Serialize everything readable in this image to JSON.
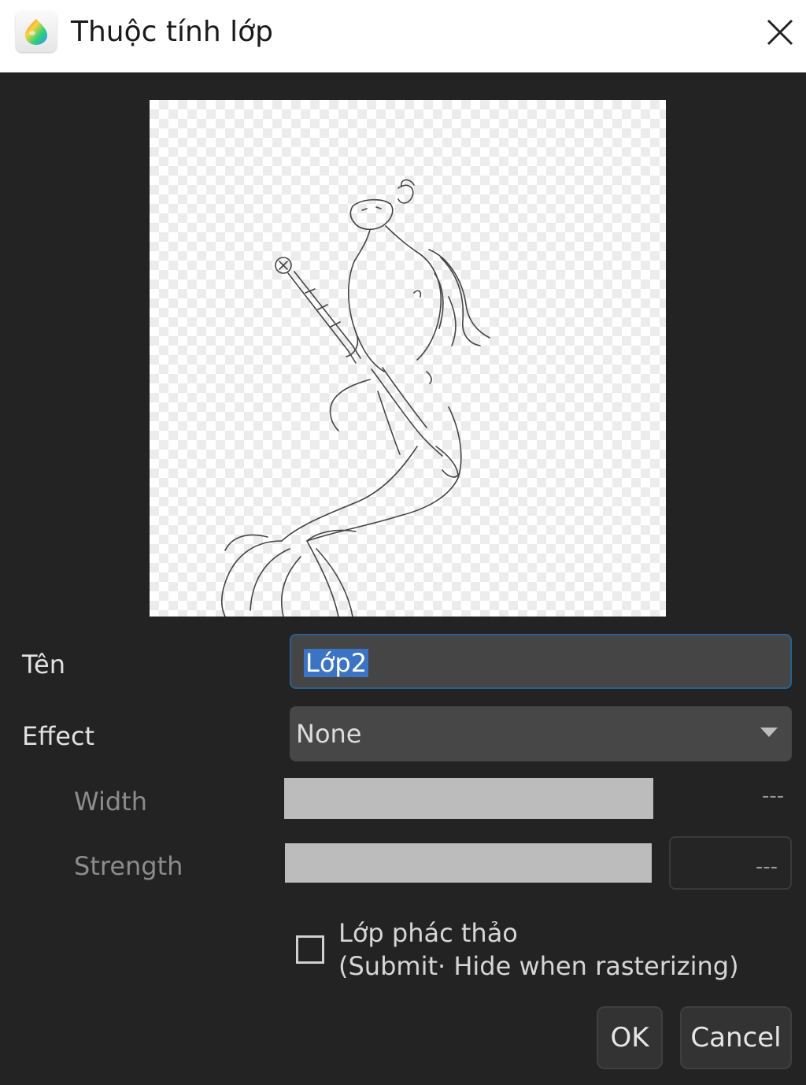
{
  "window": {
    "title": "Thuộc tính lớp",
    "icon": "medibang-paint-logo-icon",
    "close_icon": "close-icon"
  },
  "preview": {
    "icon": "layer-thumbnail",
    "background": "transparency-checkerboard",
    "line_color": "#444444"
  },
  "form": {
    "name_label": "Tên",
    "name_value": "Lớp2",
    "effect_label": "Effect",
    "effect_value": "None",
    "width_label": "Width",
    "width_value": "---",
    "strength_label": "Strength",
    "strength_value": "---"
  },
  "draft_layer": {
    "checked": false,
    "label_line1": "Lớp phác thảo",
    "label_line2": "(Submit· Hide when rasterizing)"
  },
  "buttons": {
    "ok": "OK",
    "cancel": "Cancel"
  },
  "colors": {
    "background": "#232323",
    "titlebar": "#ffffff",
    "selection": "#3b73c5",
    "focus_border": "#2c5f8f"
  }
}
